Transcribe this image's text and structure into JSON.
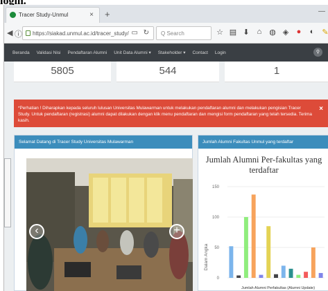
{
  "caption": "login.",
  "browser": {
    "tab_title": "Tracer Study-Unmul",
    "tab_close": "×",
    "new_tab": "+",
    "url": "https://siakad.unmul.ac.id/tracer_study/",
    "search_placeholder": "Q Search",
    "window_control": "—"
  },
  "menu": {
    "items": [
      "Beranda",
      "Validasi Nisi",
      "Pendaftaran Alumni",
      "Unit Data Alumni ▾",
      "Stakeholder ▾",
      "Contact",
      "Login"
    ]
  },
  "stats": [
    "5805",
    "544",
    "1"
  ],
  "alert": {
    "text": "*Perhatian ! Diharapkan kepada seluruh lulusan Universitas Mulawarman untuk melakukan pendaftaran alumni dan melakukan pengisian Tracer Study. Untuk pendaftaran (registrasi) alumni dapat dilakukan dengan klik menu pendaftaran dan mengisi form pendaftaran yang telah tersedia. Terima kasih.",
    "close": "×"
  },
  "panels": {
    "welcome_title": "Selamat Datang di Tracer Study Universitas Mulawarman",
    "chart_panel_title": "Jumlah Alumni Fakultas Unmul yang terdaftar",
    "prev": "‹",
    "next": "+"
  },
  "chart_data": {
    "type": "bar",
    "title": "Jumlah Alumni Per-fakultas yang terdaftar",
    "ylabel": "Dalam Angka",
    "xlabel": "Jumlah Alumni Perfakultas (Alumni Update)",
    "ylim": [
      0,
      150
    ],
    "yticks": [
      0,
      50,
      100,
      150
    ],
    "values": [
      52,
      4,
      100,
      137,
      5,
      85,
      6,
      20,
      15,
      5,
      10,
      50,
      8
    ],
    "colors": [
      "#7cb5ec",
      "#434348",
      "#90ed7d",
      "#f7a35c",
      "#8085e9",
      "#e4d354",
      "#434348",
      "#7cb5ec",
      "#2b908f",
      "#90ed7d",
      "#f45b5b",
      "#f7a35c",
      "#8085e9"
    ],
    "grid": true
  },
  "colors": {
    "menu_bg": "#3a3f44",
    "alert_bg": "#dd4b39",
    "panel_header": "#3c8dbc"
  }
}
